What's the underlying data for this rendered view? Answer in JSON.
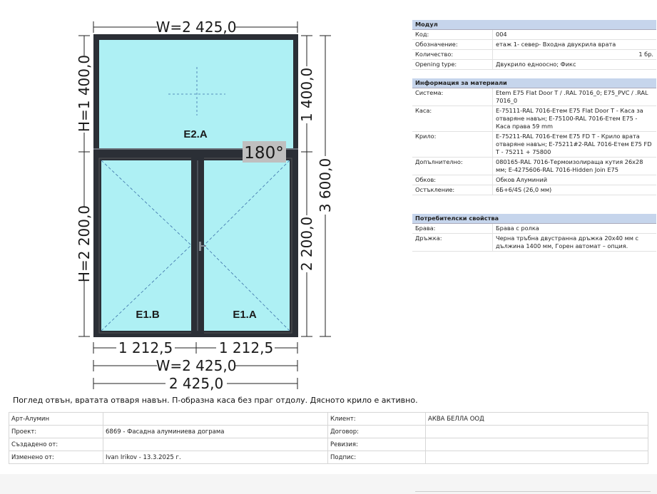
{
  "drawing": {
    "width_top": "W=2 425,0",
    "height_fixed_left": "H=1 400,0",
    "height_fixed_right": "1 400,0",
    "height_total": "3 600,0",
    "height_door_left": "H=2 200,0",
    "height_door_right": "2 200,0",
    "angle": "180°",
    "pane_top": "E2.A",
    "pane_left": "E1.B",
    "pane_right": "E1.A",
    "width_half_left": "1 212,5",
    "width_half_right": "1 212,5",
    "width_bottom_w": "W=2 425,0",
    "width_bottom": "2 425,0"
  },
  "caption": "Поглед отвън, вратата отваря навън. П-образна каса без праг отдолу. Дясното крило е активно.",
  "module": {
    "header": "Модул",
    "rows": [
      {
        "k": "Код:",
        "v": "004"
      },
      {
        "k": "Обозначение:",
        "v": "етаж 1- север- Входна двукрила врата"
      },
      {
        "k": "Количество:",
        "v": "1 бр."
      },
      {
        "k": "Opening type:",
        "v": "Двукрило едноосно; Фикс"
      }
    ]
  },
  "materials": {
    "header": "Информация за материали",
    "rows": [
      {
        "k": "Система:",
        "v": "Etem E75 Flat Door T / .RAL 7016_0; E75_PVC / .RAL 7016_0"
      },
      {
        "k": "Каса:",
        "v": "E-75111-RAL 7016-Етем E75 Flat Door T - Каса за отваряне навън; E-75100-RAL 7016-Етем E75 - Каса права 59 mm"
      },
      {
        "k": "Крило:",
        "v": "E-75211-RAL 7016-Етем E75 FD T - Крило врата отваряне навън; E-75211#2-RAL 7016-Етем E75 FD T - 75211 + 75800"
      },
      {
        "k": "Допълнително:",
        "v": "080165-RAL 7016-Термоизолираща кутия 26x28 мм; E-4275606-RAL 7016-Hidden Join E75"
      },
      {
        "k": "Обков:",
        "v": "Обков Алуминий"
      },
      {
        "k": "Остъкление:",
        "v": "6Б+6/4S (26,0 мм)"
      }
    ]
  },
  "user_props": {
    "header": "Потребителски свойства",
    "rows": [
      {
        "k": "Брава:",
        "v": "Брава с ролка"
      },
      {
        "k": "Дръжка:",
        "v": "Черна тръбна двустранна дръжка 20x40 мм с дължина 1400 мм, Горен автомат – опция."
      }
    ]
  },
  "footer": {
    "company": "Арт-Алумин",
    "client_label": "Клиент:",
    "client_value": "АКВА БЕЛЛА ООД",
    "project_label": "Проект:",
    "project_value": "6869 - Фасадна алуминиева дограма",
    "contract_label": "Договор:",
    "created_label": "Създадено от:",
    "revision_label": "Ревизия:",
    "changed_label": "Изменено от:",
    "changed_value": "Ivan Irikov - 13.3.2025 г.",
    "signature_label": "Подпис:"
  },
  "colors": {
    "frame": "#2b2f36",
    "glass": "#aef0f4",
    "header_bg": "#c6d5ec"
  }
}
